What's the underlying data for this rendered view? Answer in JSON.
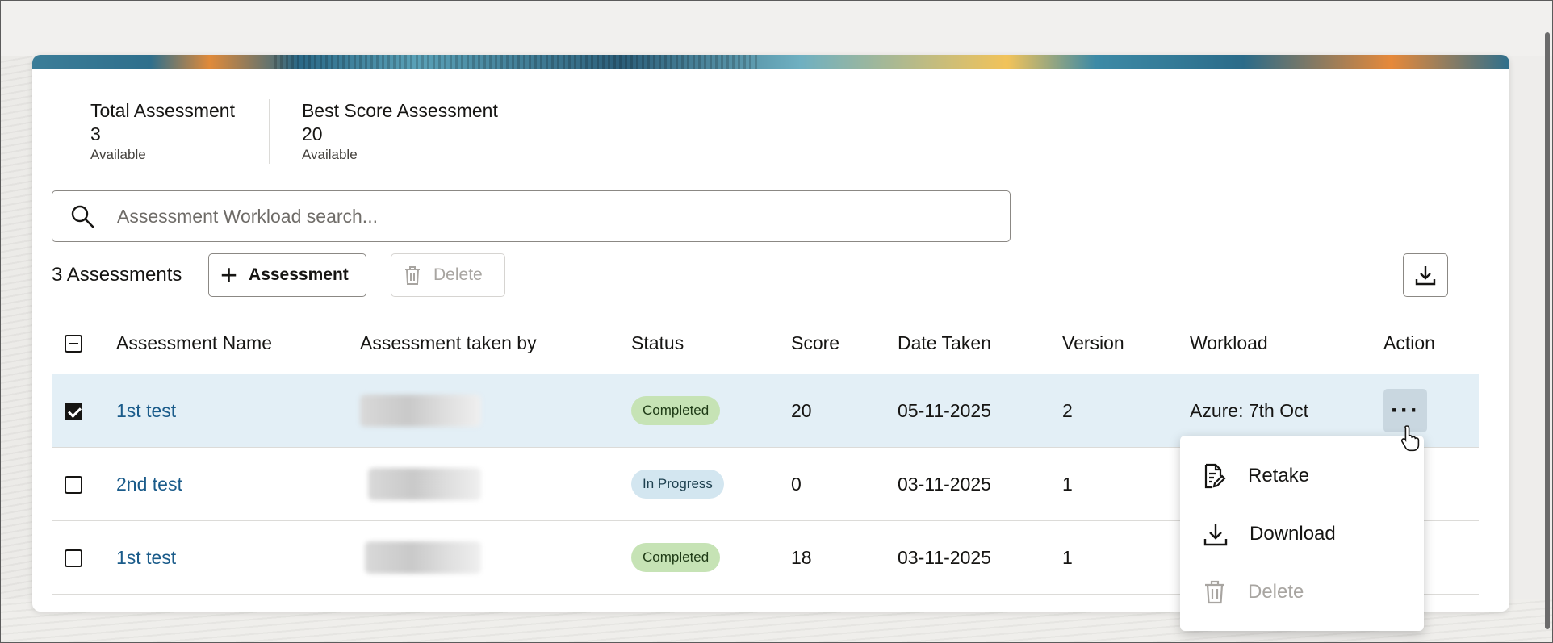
{
  "stats": [
    {
      "label": "Total Assessment",
      "value": "3",
      "sub": "Available"
    },
    {
      "label": "Best Score Assessment",
      "value": "20",
      "sub": "Available"
    }
  ],
  "search": {
    "placeholder": "Assessment Workload search..."
  },
  "toolbar": {
    "count": "3 Assessments",
    "add_label": "Assessment",
    "delete_label": "Delete"
  },
  "table": {
    "headers": [
      "Assessment Name",
      "Assessment taken by",
      "Status",
      "Score",
      "Date Taken",
      "Version",
      "Workload",
      "Action"
    ],
    "rows": [
      {
        "name": "1st test",
        "status": "Completed",
        "score": "20",
        "date": "05-11-2025",
        "version": "2",
        "workload": "Azure: 7th Oct",
        "checked": true
      },
      {
        "name": "2nd test",
        "status": "In Progress",
        "score": "0",
        "date": "03-11-2025",
        "version": "1",
        "workload": "",
        "checked": false
      },
      {
        "name": "1st test",
        "status": "Completed",
        "score": "18",
        "date": "03-11-2025",
        "version": "1",
        "workload": "",
        "checked": false
      }
    ]
  },
  "menu": {
    "items": [
      "Retake",
      "Download",
      "Delete"
    ]
  },
  "icons": {
    "search": "search-icon",
    "add": "plus-icon",
    "delete": "trash-icon",
    "export": "download-icon",
    "more": "more-horizontal-icon",
    "retake": "document-edit-icon"
  },
  "colors": {
    "link": "#1a5b8a",
    "completed_badge": "#c6e3b5",
    "progress_badge": "#d3e6f0",
    "selected_row": "#e3eff6"
  }
}
